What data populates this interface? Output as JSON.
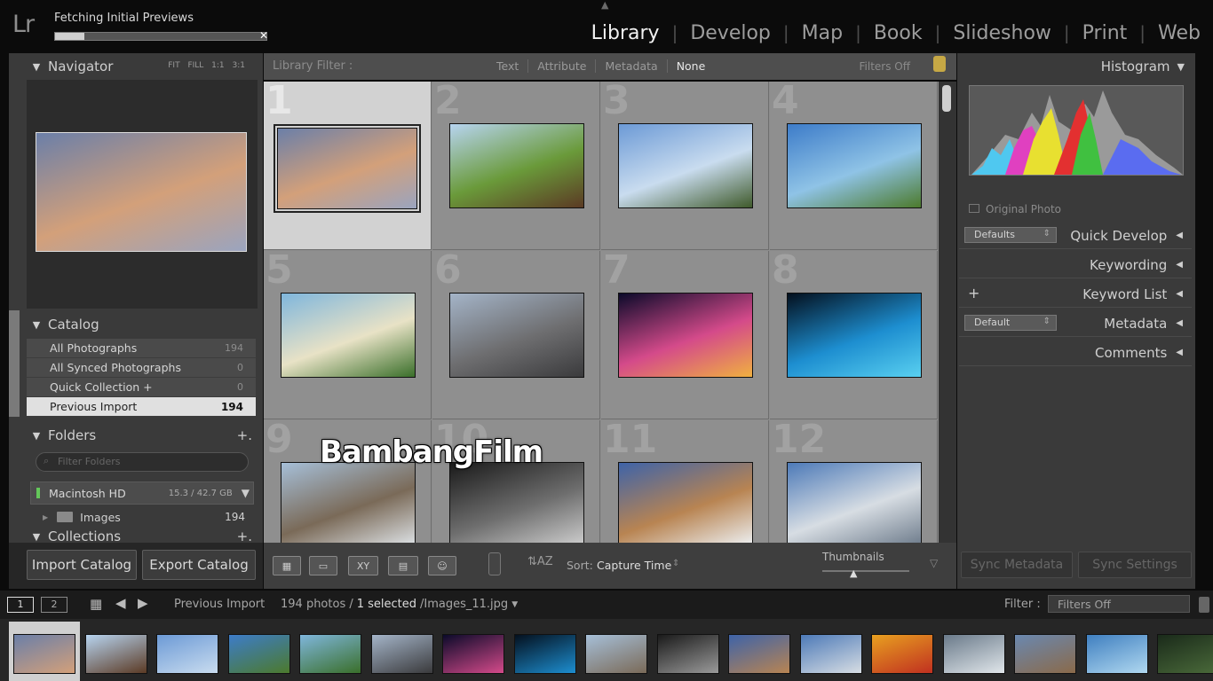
{
  "app": {
    "logo": "Lr",
    "status": "Fetching Initial Previews",
    "progress": 0.14
  },
  "modules": [
    "Library",
    "Develop",
    "Map",
    "Book",
    "Slideshow",
    "Print",
    "Web"
  ],
  "navigator": {
    "title": "Navigator",
    "modes": "FIT FILL 1:1 3:1"
  },
  "catalog": {
    "title": "Catalog",
    "items": [
      {
        "label": "All Photographs",
        "count": "194"
      },
      {
        "label": "All Synced Photographs",
        "count": "0"
      },
      {
        "label": "Quick Collection +",
        "count": "0"
      },
      {
        "label": "Previous Import",
        "count": "194"
      }
    ]
  },
  "folders": {
    "title": "Folders",
    "add": "+.",
    "search_placeholder": "Filter Folders",
    "disk": {
      "name": "Macintosh HD",
      "size": "15.3 / 42.7 GB"
    },
    "subfolder": {
      "name": "Images",
      "count": "194"
    }
  },
  "collections": {
    "title": "Collections",
    "add": "+."
  },
  "left_buttons": {
    "import": "Import Catalog",
    "export": "Export Catalog"
  },
  "library_filter": {
    "title": "Library Filter :",
    "options": [
      "Text",
      "Attribute",
      "Metadata",
      "None"
    ],
    "status": "Filters Off"
  },
  "grid": {
    "cells": [
      {
        "num": "1",
        "selected": true,
        "colors": [
          "#6b7fa8",
          "#d3a07a",
          "#9aa4bf"
        ]
      },
      {
        "num": "2",
        "colors": [
          "#b7d4f0",
          "#6a9a3a",
          "#5b3a24"
        ]
      },
      {
        "num": "3",
        "colors": [
          "#6c9ad6",
          "#c9dcef",
          "#3f5a2b"
        ]
      },
      {
        "num": "4",
        "colors": [
          "#3d7cc9",
          "#8fc3e6",
          "#4c7a2c"
        ]
      },
      {
        "num": "5",
        "colors": [
          "#7fb6dc",
          "#e8e2c6",
          "#3a6f2a"
        ]
      },
      {
        "num": "6",
        "colors": [
          "#a4b4c8",
          "#6e6e70",
          "#3a3a3c"
        ]
      },
      {
        "num": "7",
        "colors": [
          "#0b0a2a",
          "#d44a8a",
          "#f0b040"
        ]
      },
      {
        "num": "8",
        "colors": [
          "#04101e",
          "#1d8ed0",
          "#59d0f0"
        ]
      },
      {
        "num": "9",
        "colors": [
          "#a6bfd8",
          "#7a6a58",
          "#dfe4e8"
        ]
      },
      {
        "num": "10",
        "colors": [
          "#1a1a1a",
          "#6e6e6e",
          "#cfcfcf"
        ]
      },
      {
        "num": "11",
        "colors": [
          "#3e63a8",
          "#b88452",
          "#eef2f5"
        ]
      },
      {
        "num": "12",
        "colors": [
          "#4d7ab8",
          "#d7dde3",
          "#6c7a8a"
        ]
      }
    ]
  },
  "toolbar": {
    "sort_label": "Sort:",
    "sort_value": "Capture Time",
    "thumbnails_label": "Thumbnails",
    "view_icons": [
      "grid-view-icon",
      "loupe-view-icon",
      "compare-view-icon",
      "survey-view-icon",
      "people-view-icon"
    ]
  },
  "histogram": {
    "title": "Histogram",
    "original_photo": "Original Photo"
  },
  "right_panels": {
    "quick_develop": {
      "title": "Quick Develop",
      "preset": "Defaults"
    },
    "keywording": "Keywording",
    "keyword_list": "Keyword List",
    "metadata": {
      "title": "Metadata",
      "preset": "Default"
    },
    "comments": "Comments"
  },
  "right_buttons": {
    "sync_metadata": "Sync Metadata",
    "sync_settings": "Sync Settings"
  },
  "filmstrip_bar": {
    "screen1": "1",
    "screen2": "2",
    "source": "Previous Import",
    "count": "194 photos /",
    "selected": "1 selected",
    "file": "/Images_11.jpg",
    "filter_label": "Filter :",
    "filter_value": "Filters Off"
  },
  "filmstrip": [
    [
      "#6b7fa8",
      "#d3a07a"
    ],
    [
      "#b7d4f0",
      "#5b3a24"
    ],
    [
      "#6c9ad6",
      "#c9dcef"
    ],
    [
      "#3d7cc9",
      "#4c7a2c"
    ],
    [
      "#7fb6dc",
      "#3a6f2a"
    ],
    [
      "#a4b4c8",
      "#3a3a3c"
    ],
    [
      "#0b0a2a",
      "#d44a8a"
    ],
    [
      "#04101e",
      "#1d8ed0"
    ],
    [
      "#a6bfd8",
      "#7a6a58"
    ],
    [
      "#1a1a1a",
      "#9a9a9a"
    ],
    [
      "#3e63a8",
      "#b88452"
    ],
    [
      "#4d7ab8",
      "#d7dde3"
    ],
    [
      "#e8a020",
      "#c03020"
    ],
    [
      "#6a7a8a",
      "#e0e6ea"
    ],
    [
      "#6a88b0",
      "#8a6a4a"
    ],
    [
      "#3f7fc0",
      "#b0d8f0"
    ],
    [
      "#1a2a1a",
      "#4a6a3a"
    ]
  ],
  "watermark": "BambangFilm"
}
